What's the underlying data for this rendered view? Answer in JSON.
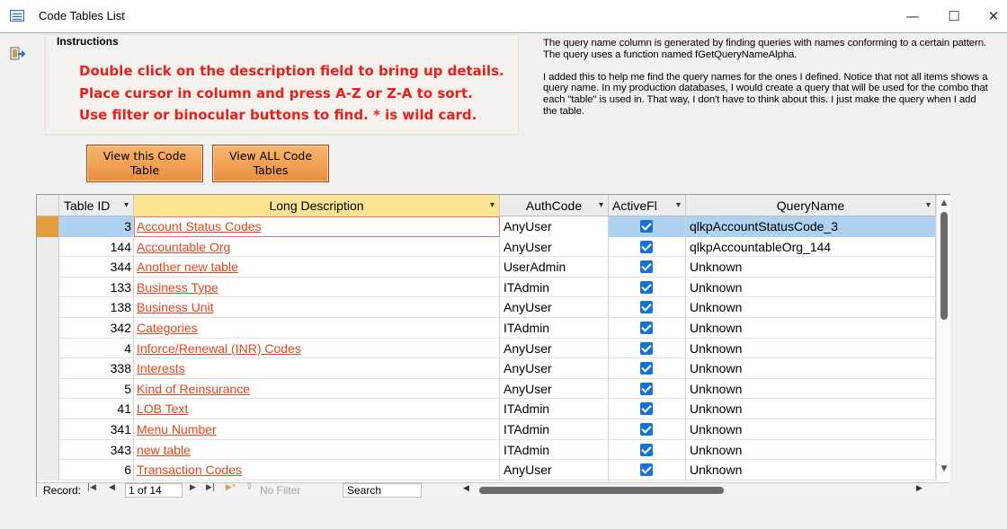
{
  "window": {
    "title": "Code Tables List",
    "min": "—",
    "max": "☐",
    "close": "✕"
  },
  "instructions": {
    "label": "Instructions",
    "lines": [
      "Double click on the description field to bring up details.",
      "Place cursor in column and press A-Z or Z-A to sort.",
      "Use filter or binocular buttons to find.  * is wild card."
    ]
  },
  "notes": [
    "The query name column is generated by finding queries with names conforming to a certain pattern.  The query uses a function named fGetQueryNameAlpha.",
    "I added this to help me find the query names for the ones I defined.  Notice that not all items shows a query name.  In my production databases, I would create a query that will be used for the combo that each \"table\" is used in.  That way, I don't have to think about this.  I just make the query when I add the table."
  ],
  "buttons": {
    "view_this": "View this Code Table",
    "view_all": "View ALL Code Tables"
  },
  "columns": {
    "table_id": "Table ID",
    "long_description": "Long Description",
    "authcode": "AuthCode",
    "activeflag": "ActiveFl",
    "queryname": "QueryName"
  },
  "rows": [
    {
      "id": "3",
      "desc": "Account Status Codes",
      "auth": "AnyUser",
      "active": true,
      "query": "qlkpAccountStatusCode_3"
    },
    {
      "id": "144",
      "desc": "Accountable Org",
      "auth": "AnyUser",
      "active": true,
      "query": "qlkpAccountableOrg_144"
    },
    {
      "id": "344",
      "desc": "Another new table",
      "auth": "UserAdmin",
      "active": true,
      "query": "Unknown"
    },
    {
      "id": "133",
      "desc": "Business Type",
      "auth": "ITAdmin",
      "active": true,
      "query": "Unknown"
    },
    {
      "id": "138",
      "desc": "Business Unit",
      "auth": "AnyUser",
      "active": true,
      "query": "Unknown"
    },
    {
      "id": "342",
      "desc": "Categories",
      "auth": "ITAdmin",
      "active": true,
      "query": "Unknown"
    },
    {
      "id": "4",
      "desc": "Inforce/Renewal (INR) Codes",
      "auth": "AnyUser",
      "active": true,
      "query": "Unknown"
    },
    {
      "id": "338",
      "desc": "Interests",
      "auth": "AnyUser",
      "active": true,
      "query": "Unknown"
    },
    {
      "id": "5",
      "desc": "Kind of Reinsurance",
      "auth": "AnyUser",
      "active": true,
      "query": "Unknown"
    },
    {
      "id": "41",
      "desc": "LOB Text",
      "auth": "ITAdmin",
      "active": true,
      "query": "Unknown"
    },
    {
      "id": "341",
      "desc": "Menu Number",
      "auth": "ITAdmin",
      "active": true,
      "query": "Unknown"
    },
    {
      "id": "343",
      "desc": "new table",
      "auth": "ITAdmin",
      "active": true,
      "query": "Unknown"
    },
    {
      "id": "6",
      "desc": "Transaction Codes",
      "auth": "AnyUser",
      "active": true,
      "query": "Unknown"
    }
  ],
  "selected_row": 0,
  "navigation": {
    "record_label": "Record:",
    "position": "1 of 14",
    "filter": "No Filter",
    "search": "Search"
  },
  "icons": {
    "app": "form-icon",
    "nav": "exit-icon",
    "sort": "dropdown-arrow-icon",
    "checkbox": "checkbox-checked-icon"
  },
  "colors": {
    "link_text": "#e8441a",
    "instructions_text": "#e8201c",
    "header_highlight": "#fce495",
    "button_orange": "#f4a356",
    "selection": "#aed2f0",
    "checkbox": "#1673d6"
  }
}
